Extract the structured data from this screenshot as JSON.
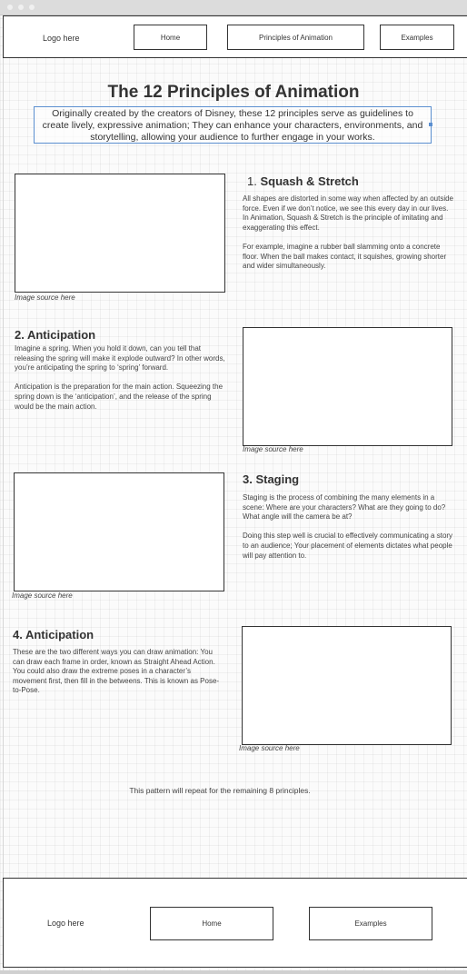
{
  "header": {
    "logo": "Logo here",
    "nav": [
      "Home",
      "Principles of Animation",
      "Examples"
    ]
  },
  "hero": {
    "title": "The 12 Principles of Animation",
    "intro": "Originally created by the creators of Disney, these 12 principles serve as guidelines to create lively, expressive animation; They can enhance your characters, environments, and storytelling, allowing your audience to further engage in your works."
  },
  "sections": [
    {
      "number": "1.",
      "title": "Squash & Stretch",
      "paragraphs": [
        "All shapes are distorted in some way when affected by an outside force. Even if we don’t notice, we see this every day in our lives. In Animation, Squash & Stretch is the principle of imitating and exaggerating this effect.",
        "For example, imagine a rubber ball slamming onto a concrete floor. When the ball makes contact, it squishes, growing shorter and wider simultaneously."
      ],
      "image_caption": "Image source here"
    },
    {
      "title": "2. Anticipation",
      "paragraphs": [
        "Imagine a spring. When you hold it down, can you tell that releasing the spring will make it explode outward? In other words, you’re anticipating the spring to ‘spring’ forward.",
        "Anticipation is the preparation for the main action. Squeezing the spring down is the ‘anticipation’, and the release of the spring would be the main action."
      ],
      "image_caption": "Image source here"
    },
    {
      "title": "3. Staging",
      "paragraphs": [
        "Staging is the process of combining the many elements in a scene: Where are your characters? What are they going to do? What angle will the camera be at?",
        "Doing this step well is crucial to effectively communicating a story to an audience;  Your placement of elements dictates what people will pay attention to."
      ],
      "image_caption": "Image source here"
    },
    {
      "title": "4. Anticipation",
      "paragraphs": [
        "These are the two different ways you can draw animation: You can draw each frame in order, known as Straight Ahead Action. You could also draw the extreme poses in a character’s movement first, then fill in the betweens. This is known as Pose-to-Pose."
      ],
      "image_caption": "Image source here"
    }
  ],
  "repeat_note": "This pattern will repeat for the remaining 8 principles.",
  "footer": {
    "logo": "Logo here",
    "nav": [
      "Home",
      "Examples"
    ]
  }
}
